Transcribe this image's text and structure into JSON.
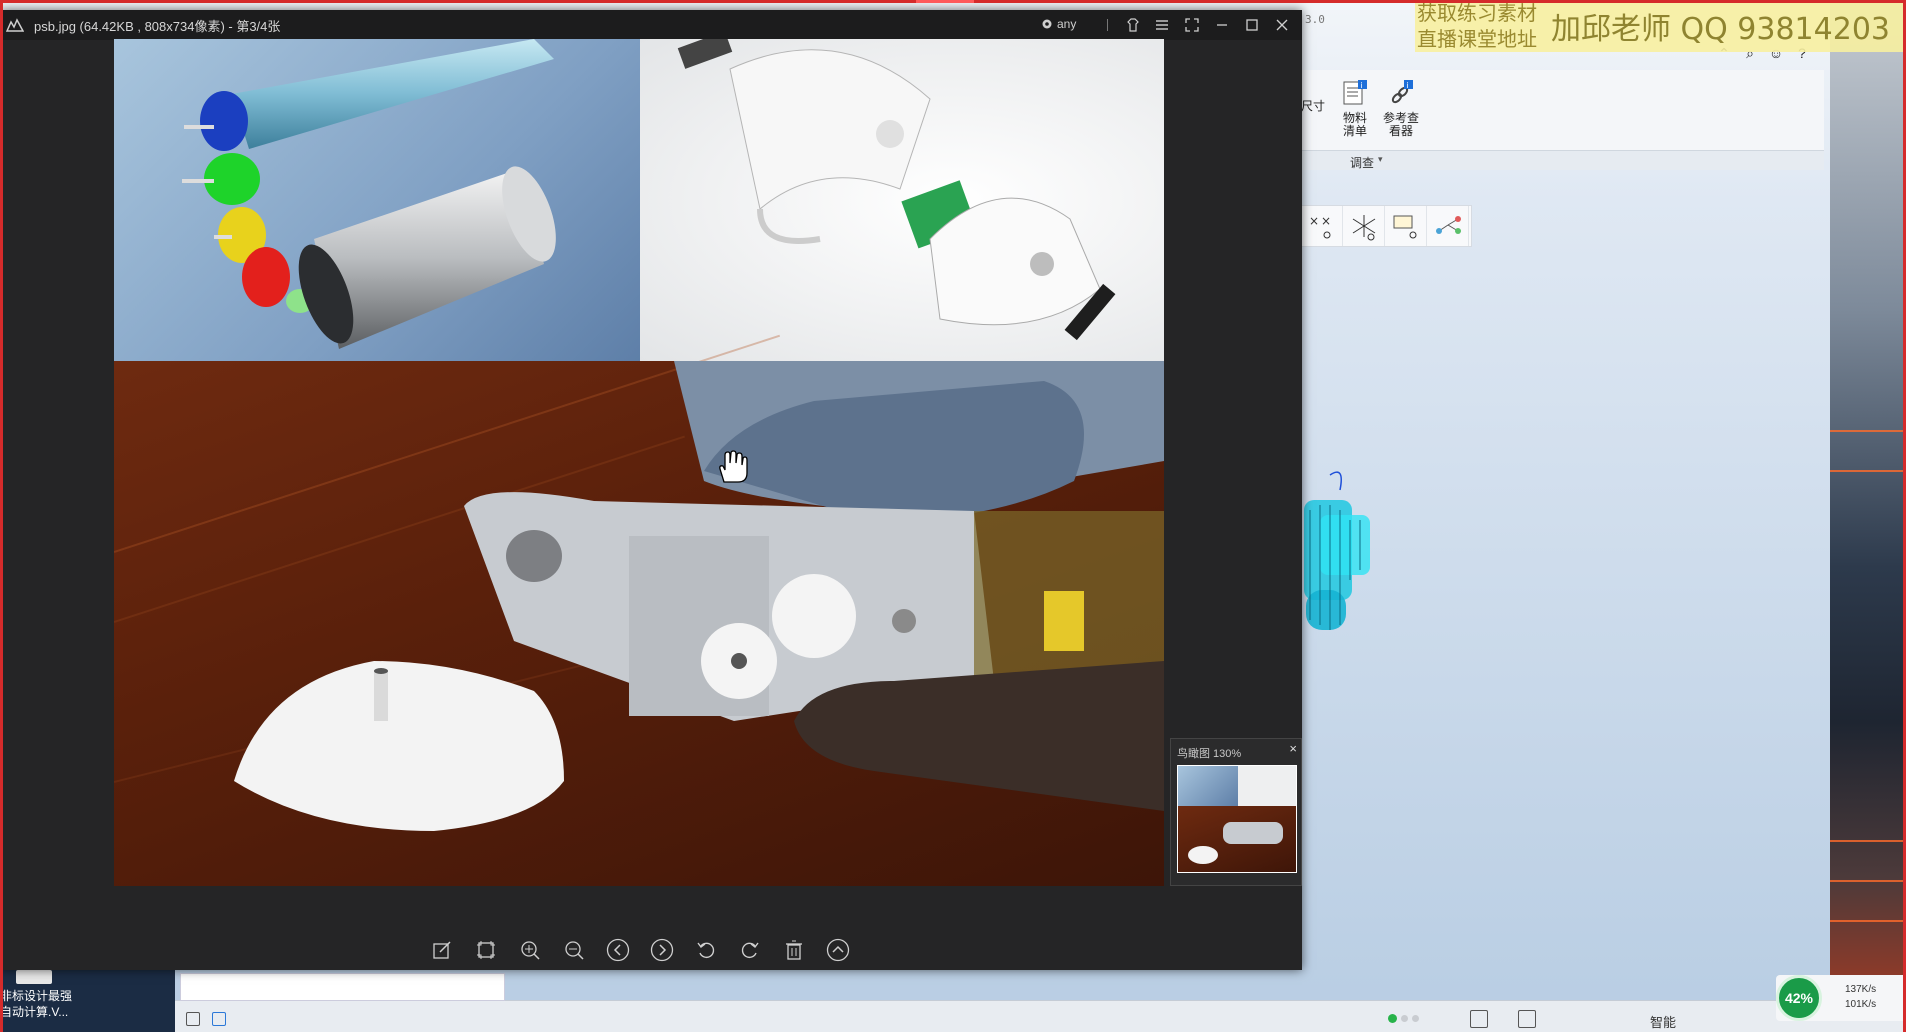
{
  "viewer": {
    "title": "psb.jpg (64.42KB , 808x734像素) - 第3/4张",
    "any_label": "any",
    "navigator_title": "鸟瞰图 130%",
    "navigator_close": "×"
  },
  "cad": {
    "version": "3.0",
    "dimension_label": "尺寸",
    "bom_label": "物料\n清单",
    "ref_viewer_label": "参考查\n看器",
    "group_label": "调查",
    "status_smart": "智能"
  },
  "watermark": {
    "line1": "获取练习素材",
    "line2": "直播课堂地址",
    "main": "加邱老师 QQ 93814203"
  },
  "desktop": {
    "icon_text_line1": "非标设计最强",
    "icon_text_line2": "自动计算.V..."
  },
  "net_meter": {
    "percent": "42%",
    "up": "137K/s",
    "down": "101K/s"
  },
  "colors": {
    "viewer_bg": "#252526",
    "titlebar_bg": "#1c1c1d",
    "accent_red": "#d52b2b",
    "net_green": "#1a9b48",
    "watermark_bg": "#f7efa0"
  }
}
